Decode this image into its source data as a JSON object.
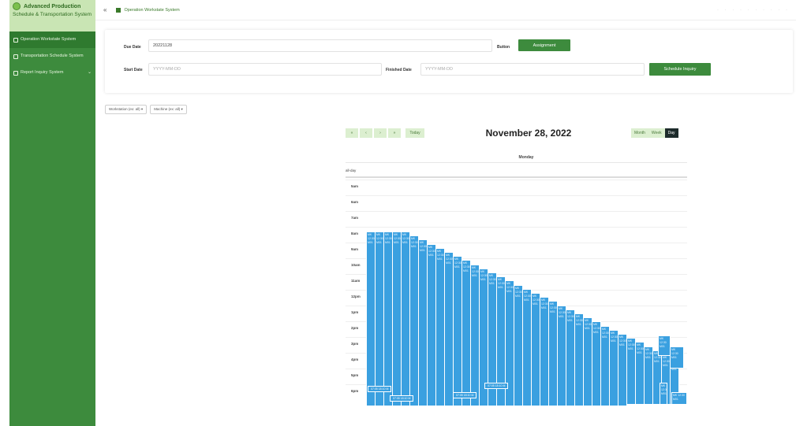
{
  "sidebar": {
    "brand_title": "Advanced Production",
    "brand_subtitle": "Schedule & Transportation System",
    "items": [
      {
        "label": "Operation Workstate System",
        "active": true,
        "icon": "user-icon"
      },
      {
        "label": "Transportation Schedule System",
        "active": false,
        "icon": "truck-icon"
      },
      {
        "label": "Report Inquiry System",
        "active": false,
        "icon": "report-icon",
        "has_submenu": true
      }
    ]
  },
  "topbar": {
    "breadcrumb": "Operation Workstate System"
  },
  "form": {
    "due_date_label": "Due Date",
    "due_date_value": "20221128",
    "button_label_text": "Button",
    "assignment_button": "Assignment",
    "start_date_label": "Start Date",
    "start_date_placeholder": "YYYY-MM-DD",
    "finished_date_label": "Finished Date",
    "finished_date_placeholder": "YYYY-MM-DD",
    "schedule_inquiry_button": "Schedule Inquiry"
  },
  "filters": [
    {
      "label": "Workstation (ex: all) ▾"
    },
    {
      "label": "Machine (ex: all) ▾"
    }
  ],
  "calendar": {
    "nav_buttons": [
      "«",
      "‹",
      "›",
      "»"
    ],
    "today_label": "Today",
    "title": "November 28, 2022",
    "views": [
      {
        "label": "Month",
        "active": false
      },
      {
        "label": "Week",
        "active": false
      },
      {
        "label": "Day",
        "active": true
      }
    ],
    "day_header": "Monday",
    "all_day_label": "all-day",
    "hours": [
      "5am",
      "6am",
      "7am",
      "8am",
      "9am",
      "10am",
      "11am",
      "12pm",
      "1pm",
      "2pm",
      "3pm",
      "4pm",
      "5pm",
      "6pm"
    ],
    "event_color": "#3aa0e0",
    "event_text": "MK 12:30 M01",
    "tags": [
      "07:05 18:10 M",
      "07:05 18:10 M",
      "07:05 18:10 M",
      "07:05 18:10 M"
    ]
  }
}
